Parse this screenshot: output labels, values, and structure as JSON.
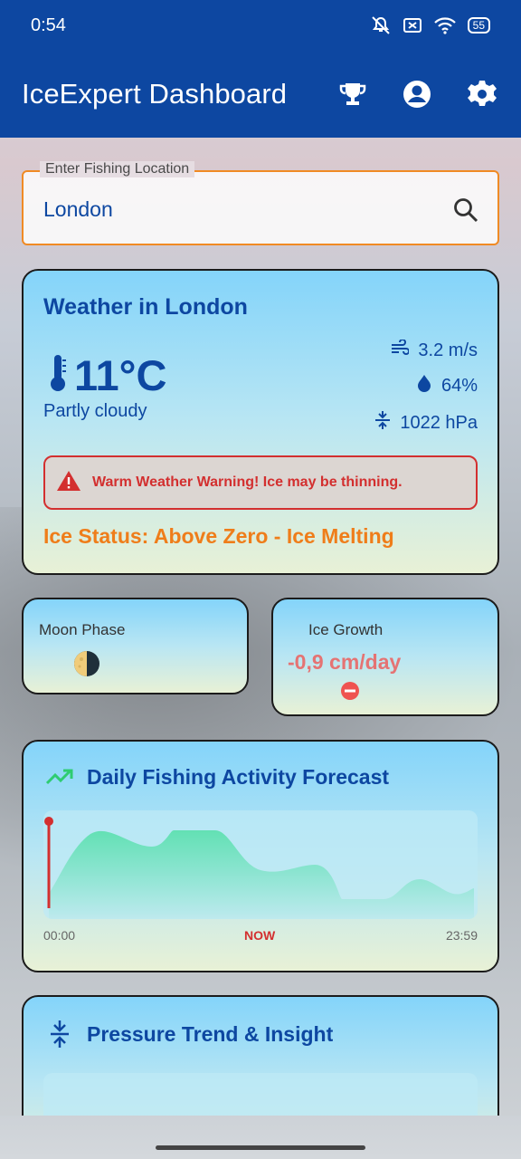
{
  "status_bar": {
    "time": "0:54",
    "battery": "55",
    "icons": [
      "mute-icon",
      "no-sim-icon",
      "wifi-icon",
      "battery-icon"
    ]
  },
  "app_bar": {
    "title": "IceExpert Dashboard",
    "actions": [
      "trophy-icon",
      "account-icon",
      "settings-icon"
    ]
  },
  "search": {
    "label": "Enter Fishing Location",
    "value": "London"
  },
  "weather": {
    "title": "Weather in London",
    "temperature": "11°C",
    "condition": "Partly cloudy",
    "wind": "3.2 m/s",
    "humidity": "64%",
    "pressure": "1022 hPa",
    "warning": "Warm Weather Warning! Ice may be thinning.",
    "ice_status": "Ice Status: Above Zero - Ice Melting"
  },
  "moon": {
    "label": "Moon Phase",
    "icon": "moon-phase-icon"
  },
  "ice_growth": {
    "label": "Ice Growth",
    "value": "-0,9 cm/day"
  },
  "forecast": {
    "title": "Daily Fishing Activity Forecast",
    "axis_start": "00:00",
    "axis_now": "NOW",
    "axis_end": "23:59"
  },
  "pressure_trend": {
    "title": "Pressure Trend & Insight"
  },
  "colors": {
    "primary": "#0d47a1",
    "accent_orange": "#ef7d1a",
    "warning_red": "#d32f2f",
    "chart_green": "#5ee0b0"
  }
}
